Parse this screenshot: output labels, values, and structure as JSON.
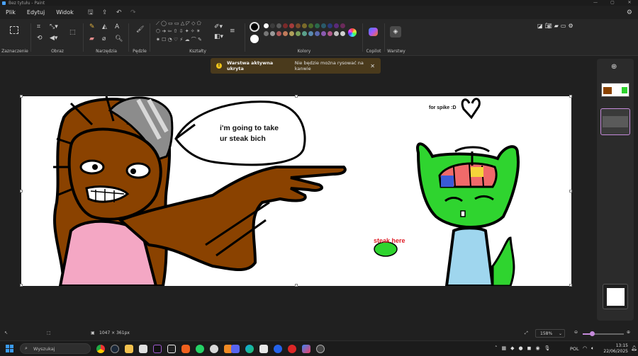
{
  "window": {
    "title": "Bez tytułu - Paint"
  },
  "menu": {
    "items": [
      "Plik",
      "Edytuj",
      "Widok"
    ]
  },
  "ribbon": {
    "groups": {
      "selection": "Zaznaczenie",
      "image": "Obraz",
      "tools": "Narzędzia",
      "brushes": "Pędzle",
      "shapes": "Kształty",
      "colors": "Kolory",
      "copilot": "Copilot",
      "layers": "Warstwy"
    },
    "palette": [
      "#ffffff",
      "#3c3c3c",
      "#5a5a5a",
      "#7a2a2a",
      "#a33b3b",
      "#7a4a2a",
      "#7a6a2a",
      "#4a6a2a",
      "#2a6a4a",
      "#2a5a6a",
      "#2a3a7a",
      "#5a2a7a",
      "#6a2a5a",
      "#777777",
      "#9a9a9a",
      "#b05a5a",
      "#c07a5a",
      "#b0a05a",
      "#7aa05a",
      "#5aa08a",
      "#5a8ab0",
      "#5a6ab0",
      "#8a5ab0",
      "#b05a8a",
      "#c0c0c0",
      "#d0d0d0"
    ]
  },
  "notification": {
    "title": "Warstwa aktywna ukryta",
    "message": "Nie będzie można rysować na kanwie"
  },
  "canvas": {
    "speech": "i'm going to take\nur steak bich",
    "dedication": "for spike :D",
    "steak_label": "steak here"
  },
  "status": {
    "dimensions": "1047 × 361px",
    "zoom": "158%"
  },
  "taskbar": {
    "search_placeholder": "Wyszukaj",
    "language": "POL",
    "time": "13:15",
    "date": "22/06/2025"
  }
}
